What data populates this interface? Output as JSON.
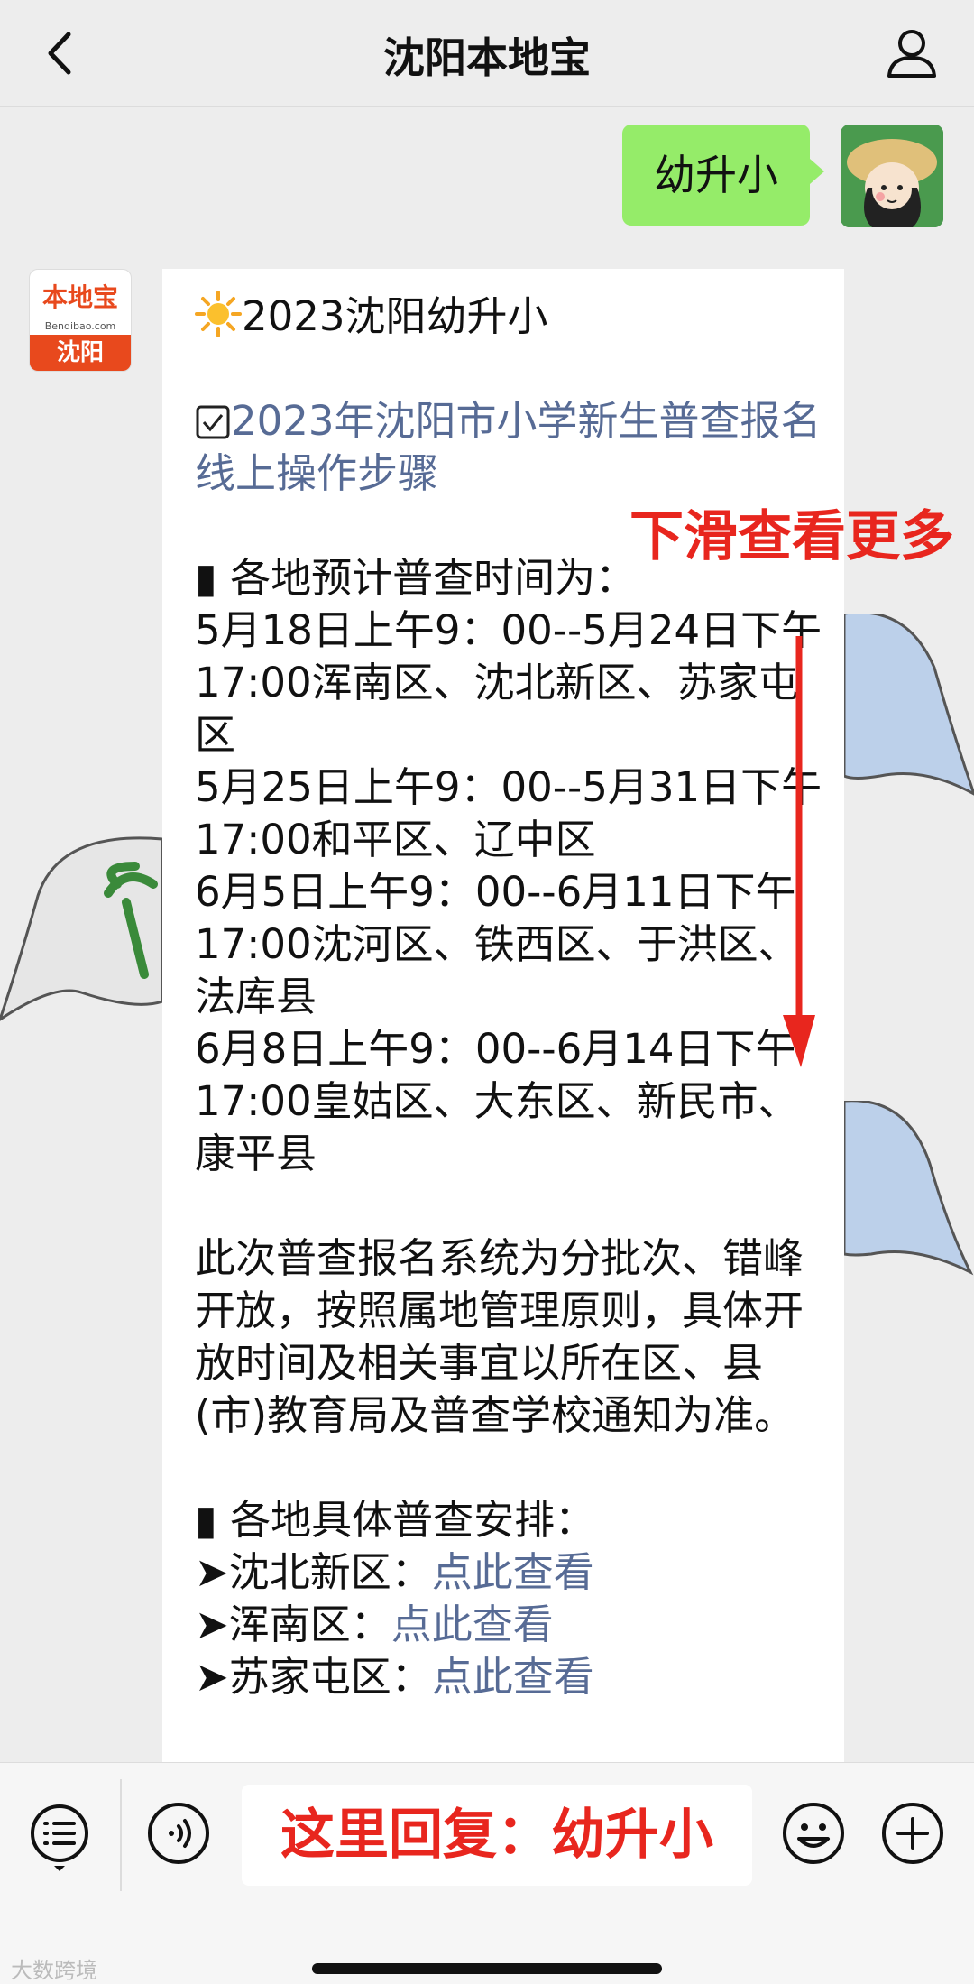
{
  "header": {
    "title": "沈阳本地宝",
    "back_icon": "chevron-left-icon",
    "profile_icon": "person-icon"
  },
  "outgoing": {
    "text": "幼升小"
  },
  "bot": {
    "logo_brand": "本地宝",
    "logo_domain": "Bendibao.com",
    "logo_city": "沈阳"
  },
  "message": {
    "title": "2023沈阳幼升小",
    "link_title": "2023年沈阳市小学新生普查报名线上操作步骤",
    "section1_heading": "▮ 各地预计普查时间为：",
    "schedule": [
      "5月18日上午9：00--5月24日下午17:00浑南区、沈北新区、苏家屯区",
      "5月25日上午9：00--5月31日下午17:00和平区、辽中区",
      "6月5日上午9：00--6月11日下午17:00沈河区、铁西区、于洪区、法库县",
      "6月8日上午9：00--6月14日下午17:00皇姑区、大东区、新民市、康平县"
    ],
    "notice": "此次普查报名系统为分批次、错峰开放，按照属地管理原则，具体开放时间及相关事宜以所在区、县(市)教育局及普查学校通知为准。",
    "section2_heading": "▮ 各地具体普查安排：",
    "districts": [
      {
        "name": "➤沈北新区：",
        "link": "点此查看"
      },
      {
        "name": "➤浑南区：",
        "link": "点此查看"
      },
      {
        "name": "➤苏家屯区：",
        "link": "点此查看"
      }
    ]
  },
  "annotation": {
    "scroll_hint": "下滑查看更多",
    "color": "#e8261e"
  },
  "bottom": {
    "input_text": "这里回复：幼升小",
    "menu_icon": "list-menu-icon",
    "voice_icon": "voice-icon",
    "emoji_icon": "emoji-icon",
    "plus_icon": "plus-icon"
  },
  "watermark": "大数跨境",
  "colors": {
    "bubble_green": "#95ec69",
    "link_blue": "#576b95",
    "background": "#ededed"
  }
}
